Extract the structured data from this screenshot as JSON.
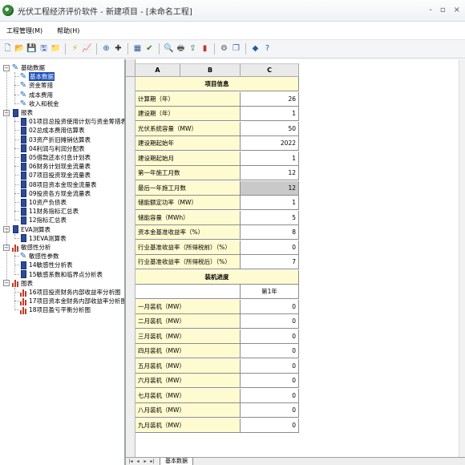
{
  "window": {
    "title": "光伏工程经济评价软件 - 新建项目 - [未命名工程]",
    "controls": [
      "-",
      "▫",
      "×"
    ]
  },
  "menu": [
    "工程管理(M)",
    "帮助(H)"
  ],
  "toolbar_icons": [
    "new-icon",
    "open-icon",
    "save-icon",
    "saveas-icon",
    "folder-icon",
    "sep",
    "lightning-icon",
    "chart-icon",
    "sep",
    "compass-icon",
    "calc-icon",
    "sep",
    "table-icon",
    "check-icon",
    "sep",
    "preview-icon",
    "print-icon",
    "export-icon",
    "bar-icon",
    "sep",
    "settings-icon",
    "copy-icon",
    "sep",
    "diamond-icon",
    "help-icon"
  ],
  "tree": {
    "basic": {
      "label": "基础数据",
      "children": [
        "基本数据",
        "资金筹措",
        "成本费用",
        "收入和税金"
      ],
      "selected_index": 0
    },
    "reports": {
      "label": "报表",
      "children": [
        "01项目总投资使用计划与资金筹措表",
        "02总成本费用估算表",
        "03资产折旧摊销估算表",
        "04利润与利润分配表",
        "05借款还本付息计划表",
        "06财务计划现金流量表",
        "07项目投资现金流量表",
        "08项目资本金现金流量表",
        "09投资各方现金流量表",
        "10资产负债表",
        "11财务指标汇总表",
        "12指标汇总表"
      ]
    },
    "eva": {
      "label": "EVA测算表",
      "children": [
        "13EVA测算表"
      ]
    },
    "sensitivity": {
      "label": "敏感性分析",
      "children": [
        "敏感性参数",
        "14敏感性分析表",
        "15敏感系数和临界点分析表"
      ]
    },
    "charts": {
      "label": "图表",
      "children": [
        "16项目投资财务内部收益率分析图",
        "17项目资本金财务内部收益率分析图",
        "18项目盈亏平衡分析图"
      ]
    }
  },
  "sheet": {
    "col_headers": [
      "A",
      "B",
      "C"
    ],
    "project_header": "项目信息",
    "rows": [
      {
        "label": "计算期（年）",
        "value": "26"
      },
      {
        "label": "建设期（年）",
        "value": "1"
      },
      {
        "label": "光伏系统容量（MW）",
        "value": "50"
      },
      {
        "label": "建设期起始年",
        "value": "2022"
      },
      {
        "label": "建设期起始月",
        "value": "1"
      },
      {
        "label": "第一年施工月数",
        "value": "12"
      },
      {
        "label": "最后一年施工月数",
        "value": "12"
      },
      {
        "label": "储能额定功率（MW）",
        "value": "1"
      },
      {
        "label": "储能容量（MWh）",
        "value": "5"
      },
      {
        "label": "资本金基准收益率（%）",
        "value": "8"
      },
      {
        "label": "行业基准收益率（所得税前）（%）",
        "value": "0"
      },
      {
        "label": "行业基准收益率（所得税后）（%）",
        "value": "7"
      }
    ],
    "install_header": "装机进度",
    "install_col": "第1年",
    "install_rows": [
      {
        "label": "一月装机（MW）",
        "value": "0"
      },
      {
        "label": "二月装机（MW）",
        "value": "0"
      },
      {
        "label": "三月装机（MW）",
        "value": "0"
      },
      {
        "label": "四月装机（MW）",
        "value": "0"
      },
      {
        "label": "五月装机（MW）",
        "value": "0"
      },
      {
        "label": "六月装机（MW）",
        "value": "0"
      },
      {
        "label": "七月装机（MW）",
        "value": "0"
      },
      {
        "label": "八月装机（MW）",
        "value": "0"
      },
      {
        "label": "九月装机（MW）",
        "value": "0"
      }
    ],
    "tab_nav": [
      "|◂",
      "◂",
      "▸",
      "▸|"
    ],
    "active_tab": "基本数据"
  },
  "colors": {
    "label_bg": "#fffbd1",
    "selected_bg": "#1c4fb8",
    "gray_value": "#c9c9c9"
  }
}
